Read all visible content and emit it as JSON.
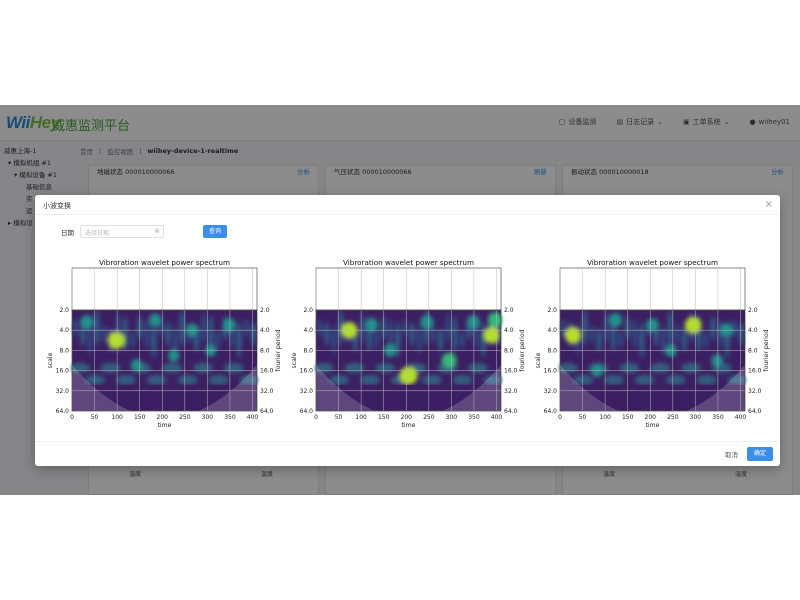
{
  "app": {
    "logo_main": "Wii",
    "logo_accent": "Hey",
    "brand": "威惠监测平台",
    "nav": [
      {
        "icon": "monitor-icon",
        "label": "设备监测"
      },
      {
        "icon": "calendar-icon",
        "label": "日志记录"
      },
      {
        "icon": "system-icon",
        "label": "工单系统"
      },
      {
        "icon": "user-icon",
        "label": "wiihey01"
      }
    ]
  },
  "breadcrumb": {
    "home": "首页",
    "view": "监控视图",
    "current": "wiihey-device-1-realtime"
  },
  "tree": [
    "威惠上海-1",
    "▾ 模拟机组 #1",
    "▾ 模拟设备 #1",
    "基础信息",
    "实",
    "运",
    "▸ 模拟设"
  ],
  "cards": [
    {
      "title": "地磁状态 000010000066",
      "action": "分析",
      "foot_left": "温度",
      "foot_right": "温度"
    },
    {
      "title": "气压状态 000010000066",
      "action": "刷新",
      "foot_left": "",
      "foot_right": ""
    },
    {
      "title": "振动状态 000010000018",
      "action": "分析",
      "foot_left": "温度",
      "foot_right": "温度"
    }
  ],
  "modal": {
    "title": "小波变换",
    "date_label": "日期",
    "date_placeholder": "选择日期",
    "query_label": "查询",
    "cancel_label": "取消",
    "ok_label": "确定"
  },
  "chart_data": [
    {
      "type": "heatmap",
      "title": "Vibroration wavelet power spectrum",
      "xlabel": "time",
      "ylabel": "scale",
      "y2label": "fourier period",
      "xticks": [
        0,
        50,
        100,
        150,
        200,
        250,
        300,
        350,
        400
      ],
      "yticks": [
        "2.0",
        "4.0",
        "8.0",
        "16.0",
        "32.0",
        "64.0"
      ],
      "y2ticks": [
        "2.0",
        "4.0",
        "8.0",
        "16.0",
        "32.0",
        "64.0"
      ]
    },
    {
      "type": "heatmap",
      "title": "Vibroration wavelet power spectrum",
      "xlabel": "time",
      "ylabel": "scale",
      "y2label": "fourier period",
      "xticks": [
        0,
        50,
        100,
        150,
        200,
        250,
        300,
        350,
        400
      ],
      "yticks": [
        "2.0",
        "4.0",
        "8.0",
        "16.0",
        "32.0",
        "64.0"
      ],
      "y2ticks": [
        "2.0",
        "4.0",
        "8.0",
        "16.0",
        "32.0",
        "64.0"
      ]
    },
    {
      "type": "heatmap",
      "title": "Vibroration wavelet power spectrum",
      "xlabel": "time",
      "ylabel": "scale",
      "y2label": "fourier period",
      "xticks": [
        0,
        50,
        100,
        150,
        200,
        250,
        300,
        350,
        400
      ],
      "yticks": [
        "2.0",
        "4.0",
        "8.0",
        "16.0",
        "32.0",
        "64.0"
      ],
      "y2ticks": [
        "2.0",
        "4.0",
        "8.0",
        "16.0",
        "32.0",
        "64.0"
      ]
    }
  ]
}
